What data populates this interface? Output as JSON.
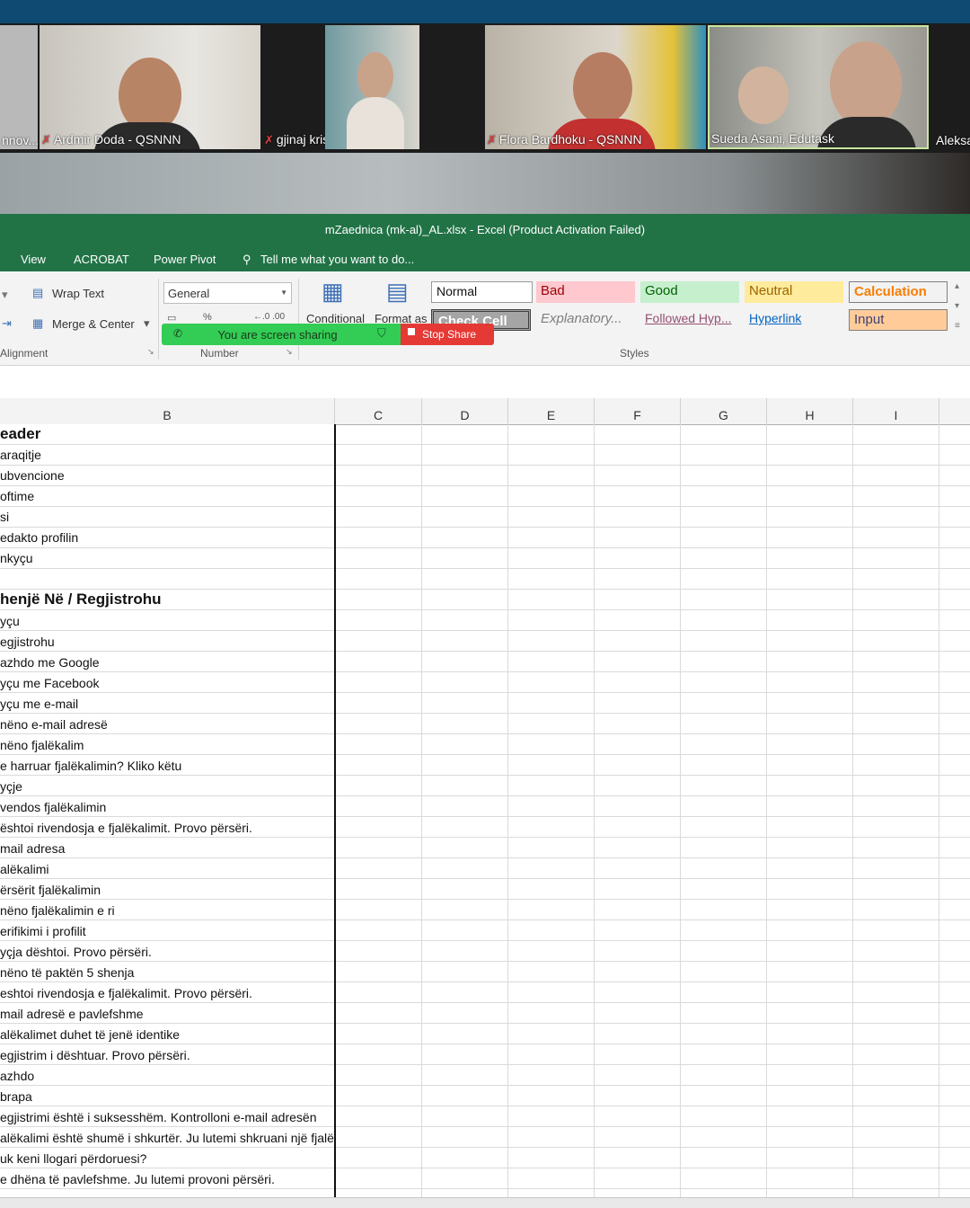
{
  "zoom": {
    "participants": [
      {
        "name": "nnov..."
      },
      {
        "name": "Ardmir Doda - QSNNN",
        "muted": true
      },
      {
        "name": "gjinaj kristina",
        "muted": true
      },
      {
        "name": "Flora Bardhoku - QSNNN",
        "muted": true
      },
      {
        "name": "Sueda Asani, Edutask"
      },
      {
        "name": "Aleksa"
      }
    ],
    "share_status": "You are screen sharing",
    "stop_share_label": "Stop Share"
  },
  "excel": {
    "title": "mZaednica (mk-al)_AL.xlsx - Excel (Product Activation Failed)",
    "tabs": [
      "View",
      "ACROBAT",
      "Power Pivot"
    ],
    "tell_me": "Tell me what you want to do...",
    "ribbon": {
      "wrap_text": "Wrap Text",
      "merge_center": "Merge & Center",
      "number_format": "General",
      "conditional": "Conditional",
      "format_as": "Format as",
      "alignment_group": "Alignment",
      "number_group": "Number",
      "styles_group": "Styles",
      "styles": {
        "normal": "Normal",
        "bad": "Bad",
        "good": "Good",
        "neutral": "Neutral",
        "calculation": "Calculation",
        "check_cell": "Check Cell",
        "explanatory": "Explanatory...",
        "followed_hyperlink": "Followed Hyp...",
        "hyperlink": "Hyperlink",
        "input": "Input"
      }
    },
    "columns": [
      "B",
      "C",
      "D",
      "E",
      "F",
      "G",
      "H",
      "I"
    ],
    "rows": [
      {
        "text": "eader",
        "bold": true
      },
      {
        "text": "araqitje"
      },
      {
        "text": "ubvencione"
      },
      {
        "text": "oftime"
      },
      {
        "text": "si"
      },
      {
        "text": "edakto profilin"
      },
      {
        "text": "nkyçu"
      },
      {
        "text": ""
      },
      {
        "text": "henjë Në / Regjistrohu",
        "bold": true
      },
      {
        "text": "yçu"
      },
      {
        "text": "egjistrohu"
      },
      {
        "text": "azhdo me Google"
      },
      {
        "text": "yçu me Facebook"
      },
      {
        "text": "yçu me e-mail"
      },
      {
        "text": "nëno e-mail adresë"
      },
      {
        "text": "nëno fjalëkalim"
      },
      {
        "text": "e harruar fjalëkalimin? Kliko këtu"
      },
      {
        "text": "yçje"
      },
      {
        "text": "vendos fjalëkalimin"
      },
      {
        "text": "ështoi rivendosja e fjalëkalimit. Provo përsëri."
      },
      {
        "text": "mail adresa"
      },
      {
        "text": "alëkalimi"
      },
      {
        "text": "ërsërit fjalëkalimin"
      },
      {
        "text": "nëno fjalëkalimin e ri"
      },
      {
        "text": "erifikimi i profilit"
      },
      {
        "text": "yçja dështoi. Provo përsëri."
      },
      {
        "text": "nëno të paktën 5 shenja"
      },
      {
        "text": "eshtoi rivendosja e fjalëkalimit. Provo përsëri."
      },
      {
        "text": "mail adresë e pavlefshme"
      },
      {
        "text": "alëkalimet duhet të jenë identike"
      },
      {
        "text": "egjistrim i dështuar. Provo përsëri."
      },
      {
        "text": "azhdo"
      },
      {
        "text": "brapa"
      },
      {
        "text": "egjistrimi është i suksesshëm. Kontrolloni e-mail adresën"
      },
      {
        "text": "alëkalimi është shumë i shkurtër. Ju lutemi shkruani një fjalëkalim më të gjatë."
      },
      {
        "text": "uk keni llogari përdoruesi?"
      },
      {
        "text": "e dhëna të pavlefshme. Ju lutemi provoni përsëri."
      }
    ]
  }
}
